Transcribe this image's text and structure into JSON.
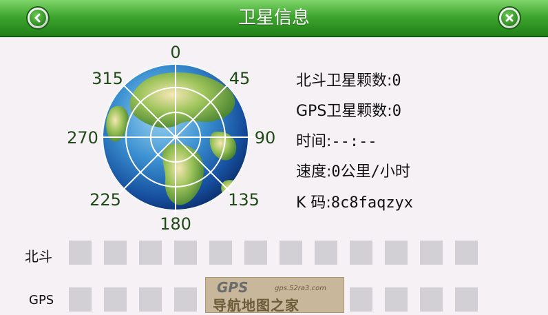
{
  "header": {
    "title": "卫星信息",
    "back_icon": "back-arrow-icon",
    "close_icon": "close-x-icon"
  },
  "compass": {
    "labels": [
      "0",
      "45",
      "90",
      "135",
      "180",
      "225",
      "270",
      "315"
    ]
  },
  "info": {
    "beidou_label": "北斗卫星颗数:",
    "beidou_value": "0",
    "gps_label": "GPS卫星颗数:",
    "gps_value": "0",
    "time_label": "时间:",
    "time_value": "--:--",
    "speed_label": "速度:",
    "speed_value": "0公里/小时",
    "code_label": "K 码:",
    "code_value": "8c8faqzyx"
  },
  "signal_rows": {
    "beidou_label": "北斗",
    "gps_label": "GPS"
  },
  "watermark": {
    "logo_text": "GPS",
    "url": "gps.52ra3.com",
    "name": "导航地图之家"
  },
  "colors": {
    "title_bar": "#3fa72f",
    "compass_label": "#1f4a17",
    "slot": "#d3d0d5"
  }
}
